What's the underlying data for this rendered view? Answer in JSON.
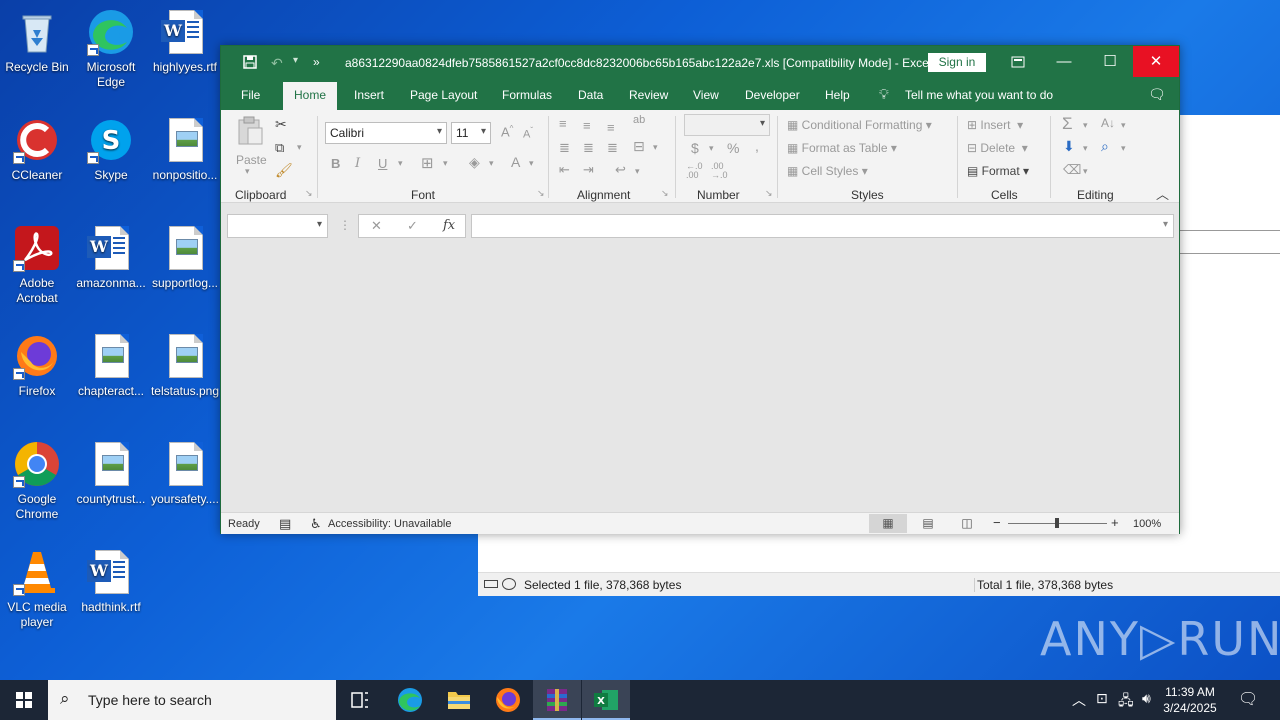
{
  "desktop": {
    "icons": [
      {
        "label": "Recycle Bin"
      },
      {
        "label": "Microsoft Edge"
      },
      {
        "label": "highlyyes.rtf"
      },
      {
        "label": "CCleaner"
      },
      {
        "label": "Skype"
      },
      {
        "label": "nonpositio..."
      },
      {
        "label": "Adobe Acrobat"
      },
      {
        "label": "amazonma..."
      },
      {
        "label": "supportlog..."
      },
      {
        "label": "Firefox"
      },
      {
        "label": "chapteract..."
      },
      {
        "label": "telstatus.png"
      },
      {
        "label": "Google Chrome"
      },
      {
        "label": "countytrust..."
      },
      {
        "label": "yoursafety...."
      },
      {
        "label": "VLC media player"
      },
      {
        "label": "hadthink.rtf"
      }
    ]
  },
  "explorer": {
    "status_selected": "Selected 1 file, 378,368 bytes",
    "status_total": "Total 1 file, 378,368 bytes"
  },
  "excel": {
    "title": "a86312290aa0824dfeb7585861527a2cf0cc8dc8232006bc65b165abc122a2e7.xls  [Compatibility Mode]  -  Excel",
    "sign_in": "Sign in",
    "tabs": [
      "File",
      "Home",
      "Insert",
      "Page Layout",
      "Formulas",
      "Data",
      "Review",
      "View",
      "Developer",
      "Help"
    ],
    "tell_me": "Tell me what you want to do",
    "ribbon": {
      "clipboard": {
        "label": "Clipboard",
        "paste": "Paste"
      },
      "font": {
        "label": "Font",
        "name": "Calibri",
        "size": "11"
      },
      "alignment": {
        "label": "Alignment"
      },
      "number": {
        "label": "Number"
      },
      "styles": {
        "label": "Styles",
        "conditional": "Conditional Formatting",
        "format_table": "Format as Table",
        "cell_styles": "Cell Styles"
      },
      "cells": {
        "label": "Cells",
        "insert": "Insert",
        "delete": "Delete",
        "format": "Format"
      },
      "editing": {
        "label": "Editing"
      }
    },
    "status": {
      "ready": "Ready",
      "accessibility": "Accessibility: Unavailable",
      "zoom": "100%"
    }
  },
  "taskbar": {
    "search_placeholder": "Type here to search",
    "time": "11:39 AM",
    "date": "3/24/2025"
  },
  "watermark": "ANY▷RUN"
}
